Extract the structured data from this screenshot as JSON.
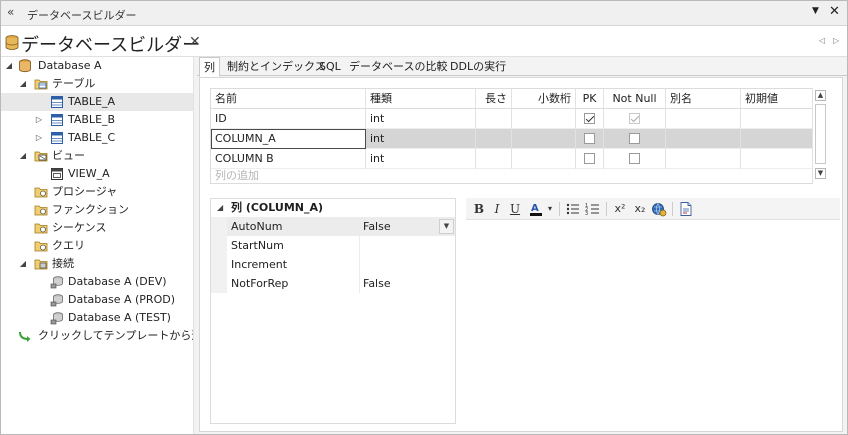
{
  "window": {
    "title": "データベースビルダー",
    "drop_glyph": "▼",
    "close_glyph": "✕",
    "grip_glyph": "«"
  },
  "doc": {
    "title": "データベースビルダー",
    "close_glyph": "✕",
    "nav_prev": "◁",
    "nav_next": "▷"
  },
  "tree": {
    "items": [
      {
        "label": "Database A",
        "icon": "database-icon",
        "toggle": "◢",
        "expanded": true
      },
      {
        "label": "テーブル",
        "icon": "folder-table-icon",
        "toggle": "◢",
        "expanded": true
      },
      {
        "label": "TABLE_A",
        "icon": "table-icon",
        "toggle": "",
        "selected": true
      },
      {
        "label": "TABLE_B",
        "icon": "table-icon",
        "toggle": "▷"
      },
      {
        "label": "TABLE_C",
        "icon": "table-icon",
        "toggle": "▷"
      },
      {
        "label": "ビュー",
        "icon": "folder-view-icon",
        "toggle": "◢",
        "expanded": true
      },
      {
        "label": "VIEW_A",
        "icon": "view-icon",
        "toggle": ""
      },
      {
        "label": "プロシージャ",
        "icon": "folder-procedure-icon",
        "toggle": ""
      },
      {
        "label": "ファンクション",
        "icon": "folder-function-icon",
        "toggle": ""
      },
      {
        "label": "シーケンス",
        "icon": "folder-sequence-icon",
        "toggle": ""
      },
      {
        "label": "クエリ",
        "icon": "folder-query-icon",
        "toggle": ""
      },
      {
        "label": "接続",
        "icon": "folder-connection-icon",
        "toggle": "◢",
        "expanded": true
      },
      {
        "label": "Database A (DEV)",
        "icon": "connection-icon",
        "toggle": ""
      },
      {
        "label": "Database A (PROD)",
        "icon": "connection-icon",
        "toggle": ""
      },
      {
        "label": "Database A (TEST)",
        "icon": "connection-icon",
        "toggle": ""
      },
      {
        "label": "クリックしてテンプレートから追加",
        "icon": "add-arrow-icon",
        "toggle": ""
      }
    ]
  },
  "tabs": [
    {
      "label": "列",
      "active": true
    },
    {
      "label": "制約とインデックス"
    },
    {
      "label": "SQL"
    },
    {
      "label": "データベースの比較"
    },
    {
      "label": "DDLの実行"
    }
  ],
  "columns_grid": {
    "headers": [
      "名前",
      "種類",
      "長さ",
      "小数桁",
      "PK",
      "Not Null",
      "別名",
      "初期値"
    ],
    "rows": [
      {
        "name": "ID",
        "type": "int",
        "length": "",
        "decimals": "",
        "pk": true,
        "not_null": true,
        "not_null_disabled": true,
        "alias": "",
        "default": ""
      },
      {
        "name": "COLUMN_A",
        "type": "int",
        "length": "",
        "decimals": "",
        "pk": false,
        "not_null": false,
        "alias": "",
        "default": "",
        "selected": true
      },
      {
        "name": "COLUMN B",
        "type": "int",
        "length": "",
        "decimals": "",
        "pk": false,
        "not_null": false,
        "alias": "",
        "default": ""
      }
    ],
    "add_placeholder": "列の追加"
  },
  "properties": {
    "header": "列 (COLUMN_A)",
    "header_toggle": "◢",
    "rows": [
      {
        "key": "AutoNum",
        "value": "False",
        "has_dropdown": true
      },
      {
        "key": "StartNum",
        "value": ""
      },
      {
        "key": "Increment",
        "value": ""
      },
      {
        "key": "NotForRep",
        "value": "False"
      }
    ],
    "dropdown_glyph": "▼"
  },
  "editor_toolbar": {
    "bold": "B",
    "italic": "I",
    "underline": "U",
    "font_color_glyph": "A",
    "bullet_glyph": "☰",
    "number_glyph": "≡",
    "superscript": "x²",
    "subscript": "x₂",
    "color_dropdown": "▾"
  }
}
